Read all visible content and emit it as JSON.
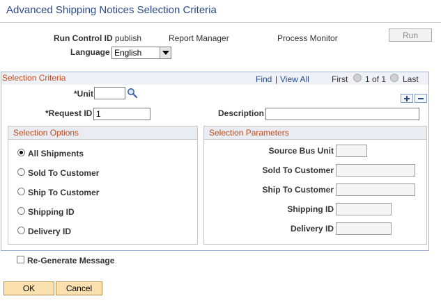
{
  "page": {
    "title": "Advanced Shipping Notices Selection Criteria"
  },
  "header": {
    "run_control_label": "Run Control ID",
    "run_control_value": "publish",
    "report_manager": "Report Manager",
    "process_monitor": "Process Monitor",
    "run_label": "Run",
    "language_label": "Language",
    "language_value": "English"
  },
  "selection": {
    "title": "Selection Criteria",
    "find": "Find",
    "sep": "|",
    "view_all": "View All",
    "first": "First",
    "count": "1 of 1",
    "last": "Last",
    "unit_label": "*Unit",
    "unit_value": "",
    "request_label": "*Request ID",
    "request_value": "1",
    "description_label": "Description",
    "description_value": ""
  },
  "options": {
    "title": "Selection Options",
    "items": [
      "All Shipments",
      "Sold To Customer",
      "Ship To Customer",
      "Shipping ID",
      "Delivery ID"
    ],
    "selected": "All Shipments"
  },
  "params": {
    "title": "Selection Parameters",
    "items": [
      "Source Bus Unit",
      "Sold To Customer",
      "Ship To Customer",
      "Shipping ID",
      "Delivery ID"
    ]
  },
  "regen_label": "Re-Generate Message",
  "buttons": {
    "ok": "OK",
    "cancel": "Cancel"
  },
  "colors": {
    "title": "#2a4a87",
    "section_title": "#c24a17",
    "button_bg": "#fbe0b0"
  },
  "icons": [
    "search-icon",
    "nav-prev-icon",
    "nav-next-icon",
    "plus-icon",
    "minus-icon",
    "dropdown-arrow-icon"
  ]
}
